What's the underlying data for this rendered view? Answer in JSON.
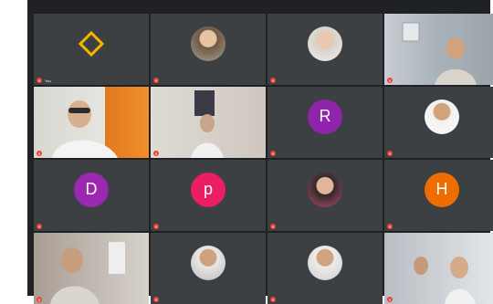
{
  "meeting": {
    "top_text": "",
    "background": "#202124"
  },
  "tiles": [
    {
      "name": "You",
      "type": "logo",
      "accent": "#f4b400"
    },
    {
      "name": "",
      "type": "photo"
    },
    {
      "name": "",
      "type": "photo"
    },
    {
      "name": "",
      "type": "video"
    },
    {
      "name": "",
      "type": "video"
    },
    {
      "name": "",
      "type": "video"
    },
    {
      "name": "",
      "type": "letter",
      "letter": "R",
      "color": "#8e24aa"
    },
    {
      "name": "",
      "type": "photo"
    },
    {
      "name": "",
      "type": "letter",
      "letter": "D",
      "color": "#9c27b0"
    },
    {
      "name": "",
      "type": "letter",
      "letter": "p",
      "color": "#e91e63"
    },
    {
      "name": "",
      "type": "photo"
    },
    {
      "name": "",
      "type": "letter",
      "letter": "H",
      "color": "#ef6c00"
    },
    {
      "name": "",
      "type": "video"
    },
    {
      "name": "",
      "type": "photo"
    },
    {
      "name": "",
      "type": "photo"
    },
    {
      "name": "",
      "type": "video"
    }
  ]
}
